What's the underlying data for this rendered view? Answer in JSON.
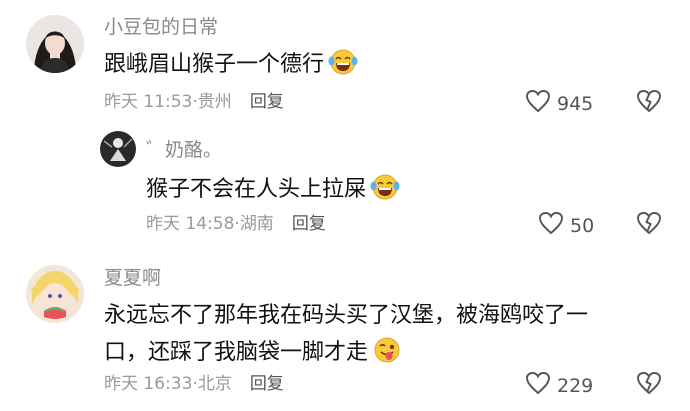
{
  "comments": [
    {
      "username": "小豆包的日常",
      "content": "跟峨眉山猴子一个德行",
      "time": "昨天 11:53",
      "location": "贵州",
      "reply_label": "回复",
      "likes": "945",
      "emoji": "grin-tears-emoji",
      "avatar": "avatar-girl-photo",
      "replies": [
        {
          "username": "゛奶酪。",
          "content": "猴子不会在人头上拉屎",
          "time": "昨天 14:58",
          "location": "湖南",
          "reply_label": "回复",
          "likes": "50",
          "emoji": "grin-tears-emoji",
          "avatar": "avatar-dark-figure"
        }
      ]
    },
    {
      "username": "夏夏啊",
      "content_lines": [
        "永远忘不了那年我在码头买了汉堡，被海鸥咬了一",
        "口，还踩了我脑袋一脚才走"
      ],
      "time": "昨天 16:33",
      "location": "北京",
      "reply_label": "回复",
      "likes": "229",
      "emoji": "tongue-emoji",
      "avatar": "avatar-anime-girl"
    }
  ],
  "colors": {
    "username": "#8a8a8a",
    "text": "#111111",
    "meta": "#9a9a9a",
    "icon": "#555555"
  }
}
